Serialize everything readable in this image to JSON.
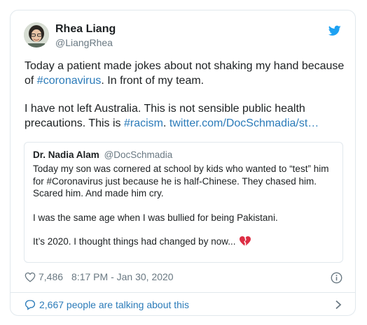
{
  "author": {
    "name": "Rhea Liang",
    "handle": "@LiangRhea"
  },
  "tweet": {
    "line1_prefix": "Today a patient made jokes about not shaking my hand because of ",
    "hashtag_coronavirus": "#coronavirus",
    "line1_suffix": ". In front of my team.",
    "line2_prefix": "I have not left Australia. This is not sensible public health precautions. This is ",
    "hashtag_racism": "#racism",
    "separator": ". ",
    "link": "twitter.com/DocSchmadia/st…"
  },
  "quoted_tweet": {
    "name": "Dr. Nadia Alam",
    "handle": "@DocSchmadia",
    "paragraph1": "Today my son was cornered at school by kids who wanted to “test” him for #Coronavirus just because he is half-Chinese. They chased him. Scared him. And made him cry.",
    "paragraph2": "I was the same age when I was bullied for being Pakistani.",
    "paragraph3": "It’s 2020. I thought things had changed by now...",
    "emoji_icon": "broken-heart-icon"
  },
  "footer": {
    "likes": "7,486",
    "timestamp": "8:17 PM - Jan 30, 2020",
    "talking": "2,667 people are talking about this"
  },
  "icons": {
    "brand": "twitter-bird-icon",
    "like": "heart-outline-icon",
    "info": "info-icon",
    "conversation": "speech-bubble-icon",
    "more": "chevron-right-icon"
  },
  "colors": {
    "link": "#2b7bb9",
    "twitter_blue": "#1da1f2",
    "secondary_text": "#697882",
    "border": "#e1e8ed",
    "broken_heart": "#dd2e44"
  }
}
